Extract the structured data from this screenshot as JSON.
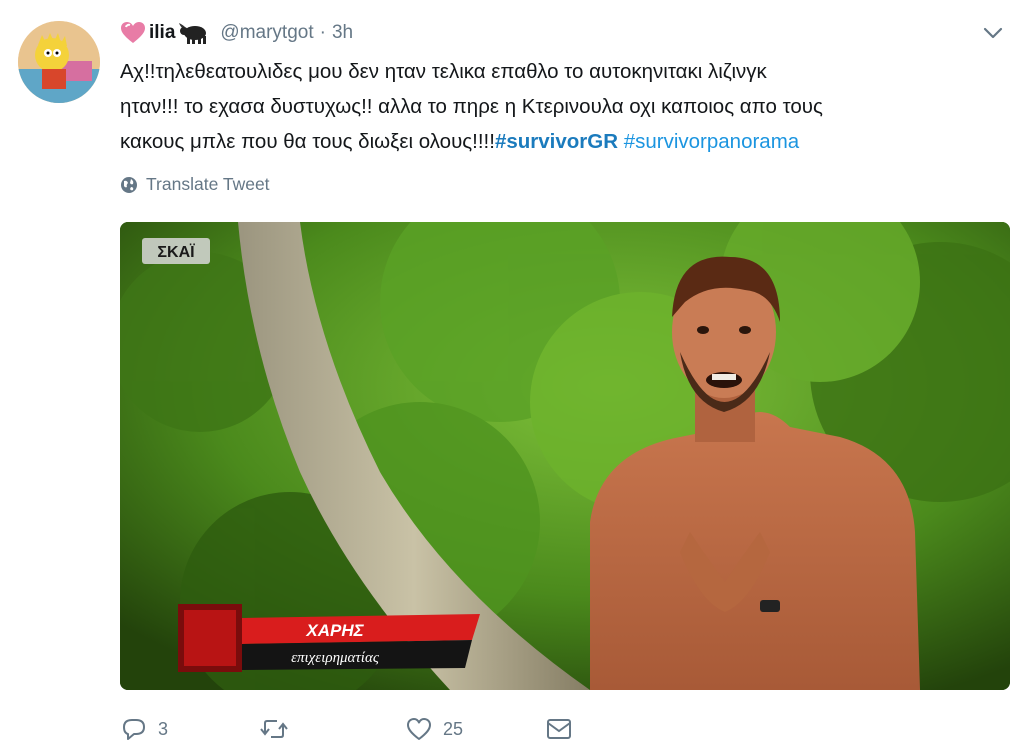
{
  "tweet": {
    "display_name": "ilia",
    "handle": "@marytgot",
    "separator": "·",
    "time": "3h",
    "text_lines": [
      "Αχ!!τηλεθεατουλιδες μου δεν ηταν τελικα επαθλο το αυτοκηνιτακι λιζινγκ",
      "ηταν!!! το εχασα δυστυχως!! αλλα το πηρε η Κτερινουλα οχι καποιος απο τους",
      "κακους μπλε που θα τους διωξει ολους!!!!"
    ],
    "hashtags": [
      "#survivorGR",
      "#survivorpanorama"
    ],
    "translate_label": "Translate Tweet"
  },
  "media": {
    "channel_logo": "ΣΚΑΪ",
    "lower_third_name": "ΧΑΡΗΣ",
    "lower_third_role": "επιχειρηματίας"
  },
  "actions": {
    "reply_count": "3",
    "retweet_count": "",
    "like_count": "25"
  },
  "icons": [
    "heart-emoji-icon",
    "bull-emoji-icon",
    "chevron-down-icon",
    "globe-icon",
    "reply-icon",
    "retweet-icon",
    "like-icon",
    "direct-message-icon"
  ],
  "colors": {
    "link_blue": "#1b95e0",
    "muted_gray": "#657786",
    "text": "#14171a"
  }
}
